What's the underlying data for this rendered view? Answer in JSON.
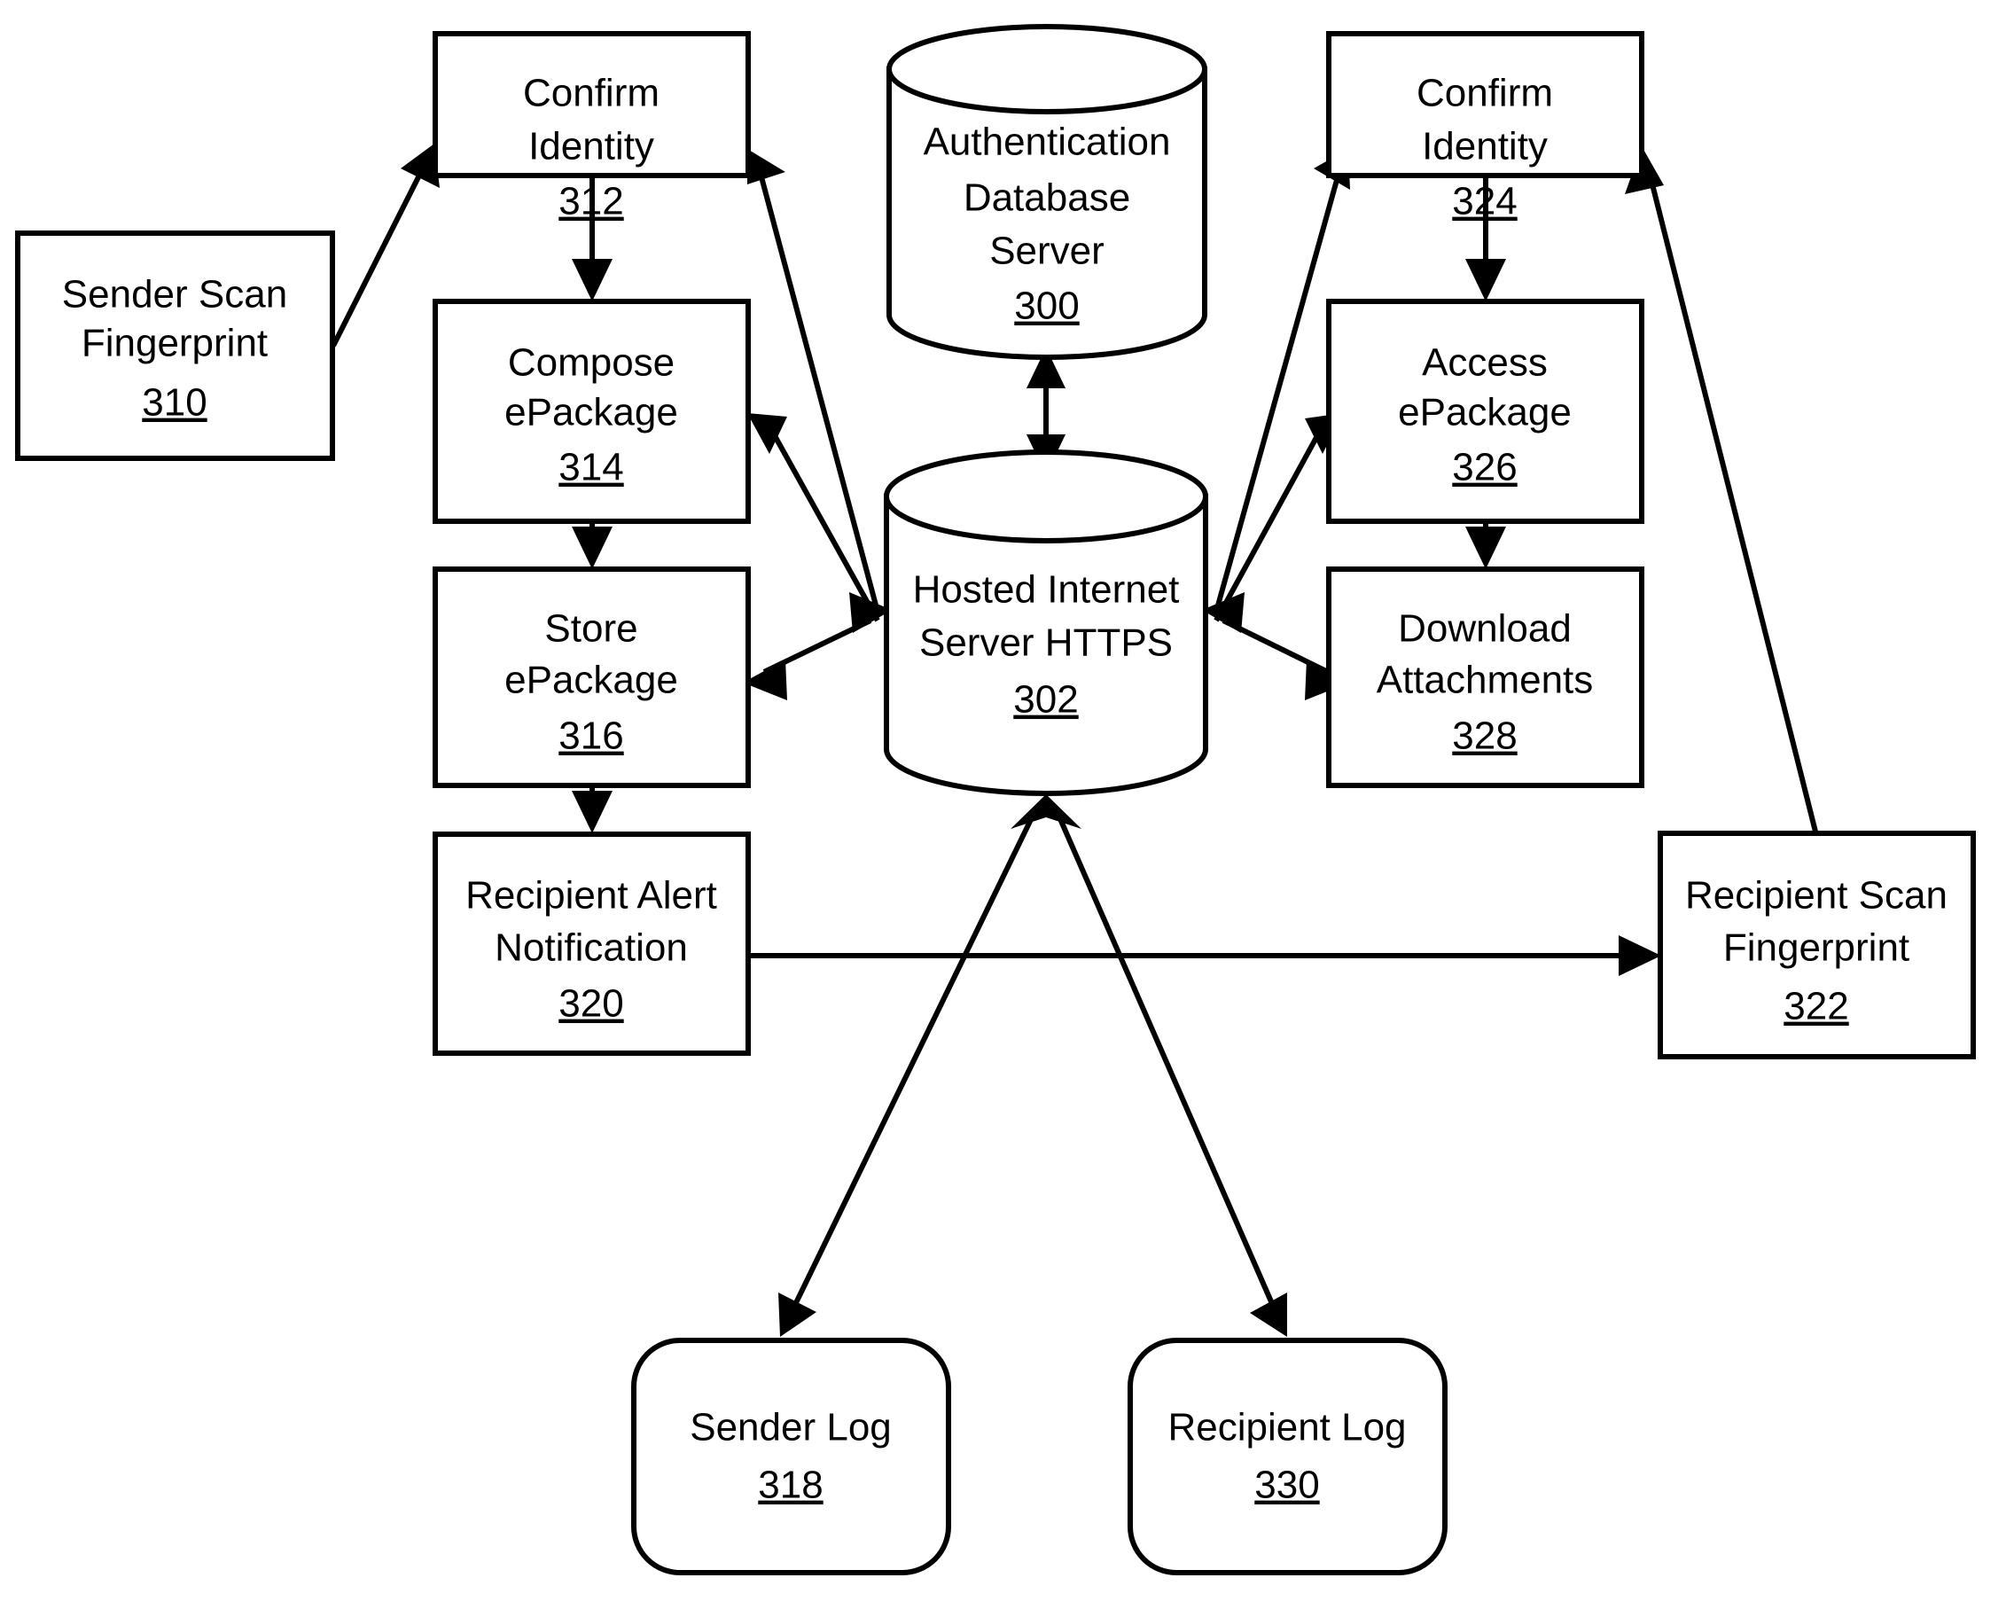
{
  "figure": {
    "type": "patent-flow-diagram",
    "title": "Secure ePackage delivery system flow"
  },
  "nodes": [
    {
      "id": "n310",
      "name": "sender-scan-fingerprint",
      "shape": "rect",
      "lines": [
        "Sender Scan",
        "Fingerprint"
      ],
      "ref": "310"
    },
    {
      "id": "n312",
      "name": "confirm-identity-sender",
      "shape": "rect",
      "lines": [
        "Confirm",
        "Identity"
      ],
      "ref": "312"
    },
    {
      "id": "n314",
      "name": "compose-epackage",
      "shape": "rect",
      "lines": [
        "Compose",
        "ePackage"
      ],
      "ref": "314"
    },
    {
      "id": "n316",
      "name": "store-epackage",
      "shape": "rect",
      "lines": [
        "Store",
        "ePackage"
      ],
      "ref": "316"
    },
    {
      "id": "n320",
      "name": "recipient-alert-notification",
      "shape": "rect",
      "lines": [
        "Recipient Alert",
        "Notification"
      ],
      "ref": "320"
    },
    {
      "id": "n300",
      "name": "authentication-database-server",
      "shape": "cylinder",
      "lines": [
        "Authentication",
        "Database",
        "Server"
      ],
      "ref": "300"
    },
    {
      "id": "n302",
      "name": "hosted-internet-server-https",
      "shape": "cylinder",
      "lines": [
        "Hosted Internet",
        "Server HTTPS"
      ],
      "ref": "302"
    },
    {
      "id": "n324",
      "name": "confirm-identity-recipient",
      "shape": "rect",
      "lines": [
        "Confirm",
        "Identity"
      ],
      "ref": "324"
    },
    {
      "id": "n326",
      "name": "access-epackage",
      "shape": "rect",
      "lines": [
        "Access",
        "ePackage"
      ],
      "ref": "326"
    },
    {
      "id": "n328",
      "name": "download-attachments",
      "shape": "rect",
      "lines": [
        "Download",
        "Attachments"
      ],
      "ref": "328"
    },
    {
      "id": "n322",
      "name": "recipient-scan-fingerprint",
      "shape": "rect",
      "lines": [
        "Recipient Scan",
        "Fingerprint"
      ],
      "ref": "322"
    },
    {
      "id": "n318",
      "name": "sender-log",
      "shape": "rounded-rect",
      "lines": [
        "Sender Log"
      ],
      "ref": "318"
    },
    {
      "id": "n330",
      "name": "recipient-log",
      "shape": "rounded-rect",
      "lines": [
        "Recipient Log"
      ],
      "ref": "330"
    }
  ],
  "edges": [
    {
      "from": "n310",
      "to": "n312",
      "arrows": "one-way"
    },
    {
      "from": "n312",
      "to": "n314",
      "arrows": "one-way"
    },
    {
      "from": "n314",
      "to": "n316",
      "arrows": "one-way"
    },
    {
      "from": "n316",
      "to": "n320",
      "arrows": "one-way"
    },
    {
      "from": "n302",
      "to": "n312",
      "arrows": "one-way"
    },
    {
      "from": "n302",
      "to": "n314",
      "arrows": "one-way"
    },
    {
      "from": "n316",
      "to": "n302",
      "arrows": "two-way"
    },
    {
      "from": "n300",
      "to": "n302",
      "arrows": "two-way"
    },
    {
      "from": "n302",
      "to": "n324",
      "arrows": "one-way"
    },
    {
      "from": "n302",
      "to": "n326",
      "arrows": "one-way"
    },
    {
      "from": "n328",
      "to": "n302",
      "arrows": "two-way"
    },
    {
      "from": "n324",
      "to": "n326",
      "arrows": "one-way"
    },
    {
      "from": "n326",
      "to": "n328",
      "arrows": "one-way"
    },
    {
      "from": "n320",
      "to": "n322",
      "arrows": "one-way"
    },
    {
      "from": "n322",
      "to": "n324",
      "arrows": "one-way"
    },
    {
      "from": "n302",
      "to": "n318",
      "arrows": "one-way"
    },
    {
      "from": "n302",
      "to": "n330",
      "arrows": "one-way"
    }
  ],
  "style": {
    "line_color": "#000000",
    "fill_color": "#ffffff",
    "background": "#ffffff"
  }
}
